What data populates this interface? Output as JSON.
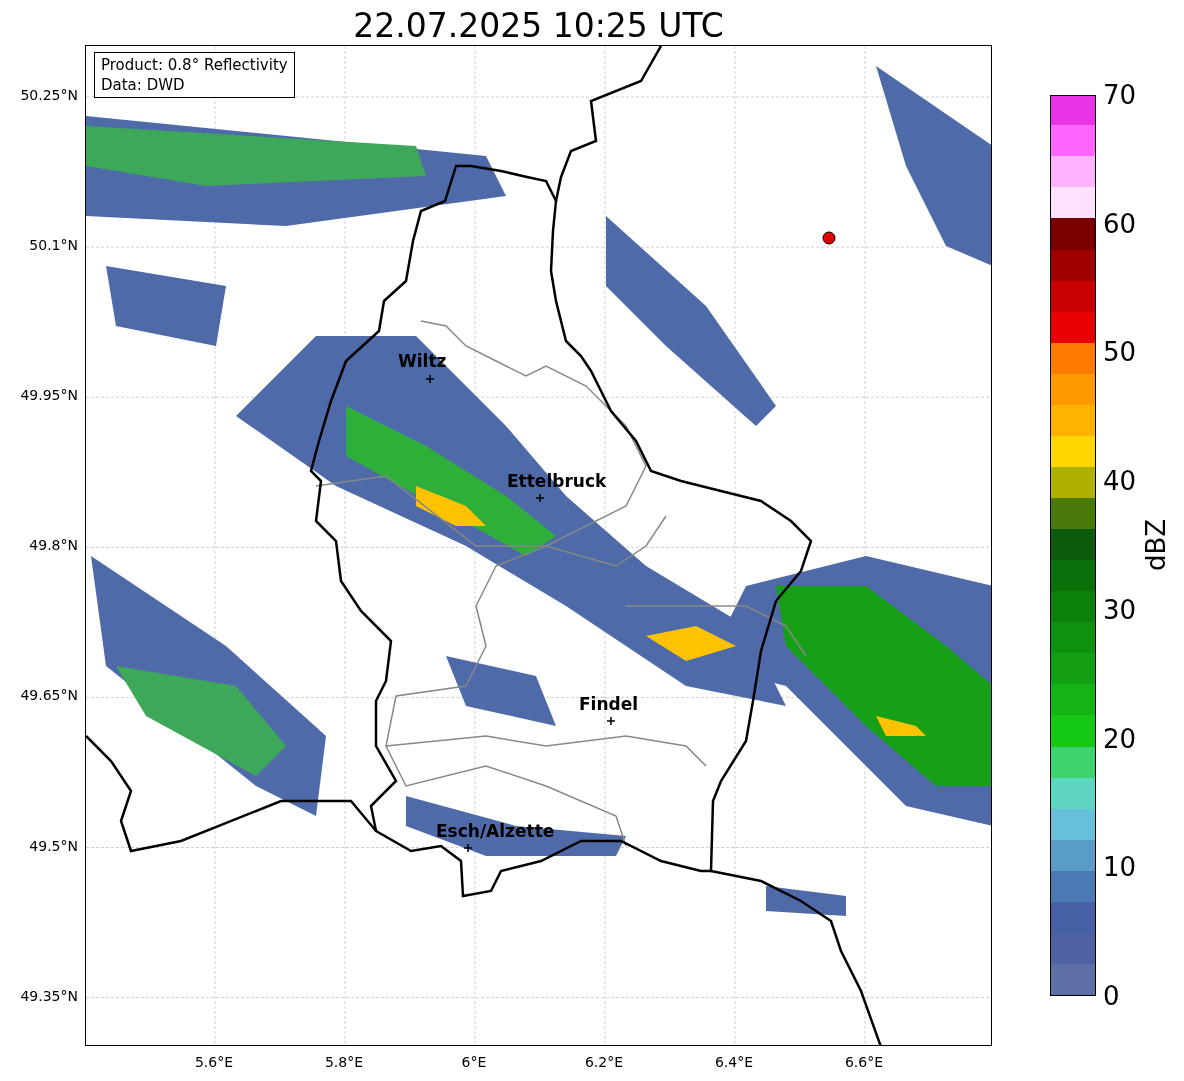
{
  "title": "22.07.2025 10:25 UTC",
  "info_box": {
    "lines": [
      "Product: 0.8° Reflectivity",
      "Data: DWD"
    ]
  },
  "map": {
    "lat_ticks": [
      "50.25°N",
      "50.1°N",
      "49.95°N",
      "49.8°N",
      "49.65°N",
      "49.5°N",
      "49.35°N"
    ],
    "lon_ticks": [
      "5.6°E",
      "5.8°E",
      "6°E",
      "6.2°E",
      "6.4°E",
      "6.6°E"
    ],
    "places": [
      {
        "name": "Wiltz"
      },
      {
        "name": "Ettelbruck"
      },
      {
        "name": "Findel"
      },
      {
        "name": "Esch/Alzette"
      }
    ]
  },
  "colorbar": {
    "label": "dBZ",
    "ticks": [
      "70",
      "60",
      "50",
      "40",
      "30",
      "20",
      "10",
      "0"
    ],
    "segments": [
      {
        "color": "#5c70a6"
      },
      {
        "color": "#4e62a2"
      },
      {
        "color": "#4660a6"
      },
      {
        "color": "#4a7ab4"
      },
      {
        "color": "#5a9cc8"
      },
      {
        "color": "#66c0dc"
      },
      {
        "color": "#5fd6c0"
      },
      {
        "color": "#3dd470"
      },
      {
        "color": "#14c814"
      },
      {
        "color": "#14b414"
      },
      {
        "color": "#12a012"
      },
      {
        "color": "#0f900f"
      },
      {
        "color": "#0a820a"
      },
      {
        "color": "#0a700a"
      },
      {
        "color": "#0a5c0a"
      },
      {
        "color": "#4a7a0a"
      },
      {
        "color": "#b0b000"
      },
      {
        "color": "#ffd700"
      },
      {
        "color": "#ffb300"
      },
      {
        "color": "#ff9900"
      },
      {
        "color": "#ff7a00"
      },
      {
        "color": "#e60000"
      },
      {
        "color": "#c80000"
      },
      {
        "color": "#a00000"
      },
      {
        "color": "#7a0000"
      },
      {
        "color": "#ffe0ff"
      },
      {
        "color": "#ffb3ff"
      },
      {
        "color": "#ff66ff"
      },
      {
        "color": "#e833e8"
      }
    ]
  }
}
